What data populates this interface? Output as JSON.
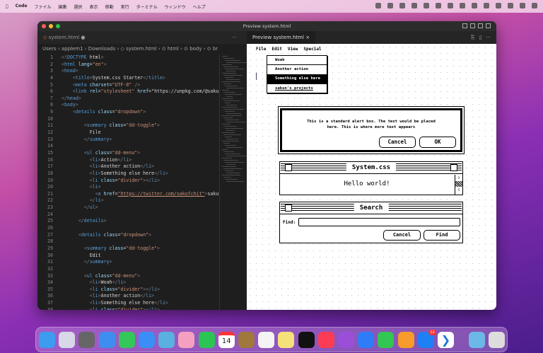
{
  "menubar": {
    "items": [
      "Code",
      "ファイル",
      "編集",
      "選択",
      "表示",
      "移動",
      "実行",
      "ターミナル",
      "ウィンドウ",
      "ヘルプ"
    ]
  },
  "window": {
    "title": "Preview system.html"
  },
  "editor": {
    "tab": "system.html",
    "tab_modified": "●",
    "more": "···",
    "breadcrumb": "Users › applem1 › Downloads › ◇ system.html › ⊙ html › ⊙ body › ⊙ br",
    "lines": [
      "<!DOCTYPE html>",
      "<html lang=\"en\">",
      "<head>",
      "    <title>System.css Starter</title>",
      "    <meta charset=\"UTF-8\" />",
      "    <link rel=\"stylesheet\" href=\"https://unpkg.com/@sakun/",
      "</head>",
      "<body>",
      "    <details class=\"dropdown\">",
      "",
      "        <summary class=\"dd-toggle\">",
      "          File",
      "        </summary>",
      "",
      "        <ul class=\"dd-menu\">",
      "          <li>Action</li>",
      "          <li>Another action</li>",
      "          <li>Something else here</li>",
      "          <li class=\"divider\"></li>",
      "          <li>",
      "            <a href=\"https://twitter.com/sakofchit\">sakun'",
      "          </li>",
      "        </ul>",
      "",
      "      </details>",
      "",
      "      <details class=\"dropdown\">",
      "",
      "        <summary class=\"dd-toggle\">",
      "          Edit",
      "        </summary>",
      "",
      "        <ul class=\"dd-menu\">",
      "          <li>Woah</li>",
      "          <li class=\"divider\"></li>",
      "          <li>Another action</li>",
      "          <li>Something else here</li>",
      "          <li class=\"divider\"></li>"
    ]
  },
  "preview": {
    "tab": "Preview system.html",
    "close": "×",
    "menu": [
      "File",
      "Edit",
      "View",
      "Special"
    ],
    "dropdown": [
      "Woah",
      "Another action",
      "Something else here",
      "sakun's projects"
    ],
    "alert": {
      "text": "This is a standard alert box. The text would be placed here. This is where more text appears",
      "cancel": "Cancel",
      "ok": "OK"
    },
    "system_window": {
      "title": "System.css",
      "body": "Hello world!"
    },
    "search_window": {
      "title": "Search",
      "label": "Find:",
      "value": "",
      "cancel": "Cancel",
      "find": "Find"
    }
  },
  "dock": {
    "calendar_day": "14",
    "appstore_badge": "12",
    "apps": [
      "finder",
      "launchpad",
      "system-preferences",
      "safari",
      "messages",
      "mail",
      "maps",
      "photos",
      "facetime",
      "calendar",
      "contacts",
      "reminders",
      "notes",
      "apple-tv",
      "music",
      "podcasts",
      "keynote",
      "numbers",
      "pages",
      "app-store",
      "vscode",
      "downloads",
      "trash"
    ]
  }
}
